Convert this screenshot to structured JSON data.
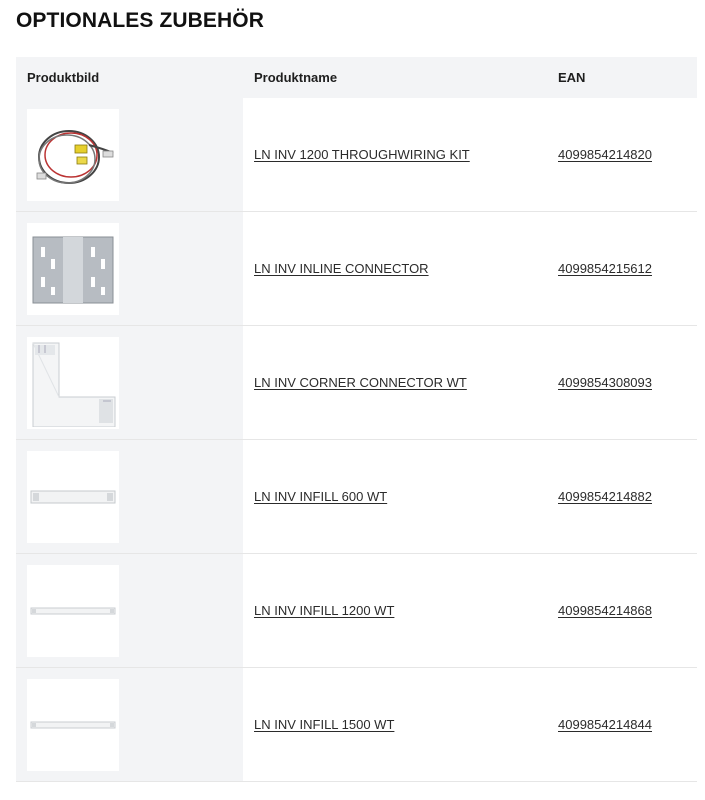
{
  "title": "OPTIONALES ZUBEHÖR",
  "table": {
    "headers": {
      "image": "Produktbild",
      "name": "Produktname",
      "ean": "EAN"
    },
    "rows": [
      {
        "name": "LN INV 1200 THROUGHWIRING KIT",
        "ean": "4099854214820",
        "icon": "wiring-kit-icon"
      },
      {
        "name": "LN INV INLINE CONNECTOR",
        "ean": "4099854215612",
        "icon": "inline-connector-icon"
      },
      {
        "name": "LN INV CORNER CONNECTOR WT",
        "ean": "4099854308093",
        "icon": "corner-connector-icon"
      },
      {
        "name": "LN INV INFILL 600 WT",
        "ean": "4099854214882",
        "icon": "infill-600-icon"
      },
      {
        "name": "LN INV INFILL 1200 WT",
        "ean": "4099854214868",
        "icon": "infill-1200-icon"
      },
      {
        "name": "LN INV INFILL 1500 WT",
        "ean": "4099854214844",
        "icon": "infill-1500-icon"
      }
    ]
  }
}
